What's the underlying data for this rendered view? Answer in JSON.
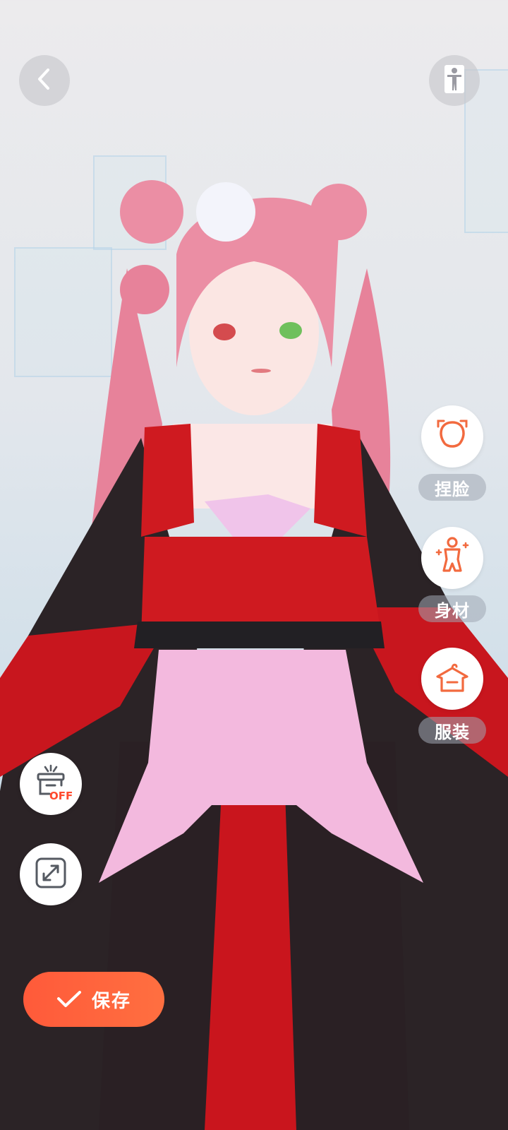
{
  "header": {
    "back_icon": "back-arrow-icon",
    "pose_icon": "pose-figure-icon"
  },
  "side_menu": [
    {
      "id": "face",
      "label": "捏脸",
      "icon": "face-icon"
    },
    {
      "id": "body",
      "label": "身材",
      "icon": "body-figure-icon"
    },
    {
      "id": "outfit",
      "label": "服装",
      "icon": "hanger-shirt-icon"
    }
  ],
  "tools": {
    "pedestal_badge": "OFF",
    "pedestal_icon": "pedestal-off-icon",
    "expand_icon": "expand-icon"
  },
  "save": {
    "label": "保存",
    "icon": "check-icon"
  },
  "colors": {
    "accent": "#ff5a3a",
    "icon_orange": "#f26a3f"
  }
}
